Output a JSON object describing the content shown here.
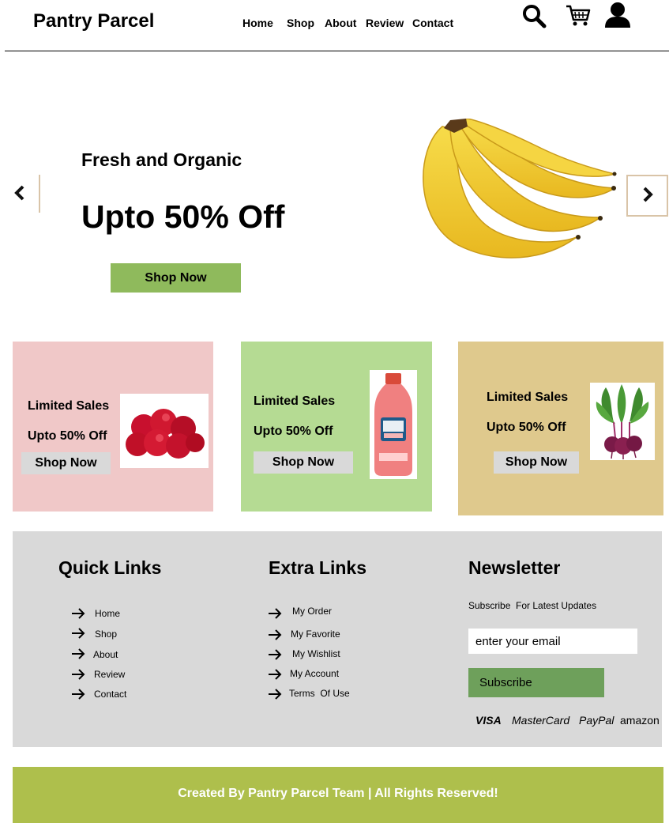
{
  "header": {
    "brand": "Pantry Parcel",
    "nav": [
      "Home",
      "Shop",
      "About",
      "Review",
      "Contact"
    ]
  },
  "hero": {
    "subtitle": "Fresh and Organic",
    "title": "Upto 50% Off",
    "button": "Shop Now"
  },
  "promos": [
    {
      "line1": "Limited Sales",
      "line2": "Upto 50% Off",
      "button": "Shop Now",
      "bg": "#f0c8c8",
      "image": "apples"
    },
    {
      "line1": "Limited Sales",
      "line2": "Upto 50% Off",
      "button": "Shop Now",
      "bg": "#b5db93",
      "image": "juice-bottle"
    },
    {
      "line1": "Limited Sales",
      "line2": "Upto 50% Off",
      "button": "Shop Now",
      "bg": "#dfc98d",
      "image": "beets"
    }
  ],
  "footer": {
    "quick_title": "Quick Links",
    "quick_links": [
      "Home",
      "Shop",
      "About",
      "Review",
      "Contact"
    ],
    "extra_title": "Extra Links",
    "extra_links": [
      "My Order",
      "My Favorite",
      "My Wishlist",
      "My Account",
      "Terms  Of Use"
    ],
    "newsletter_title": "Newsletter",
    "newsletter_text": "Subscribe  For Latest Updates",
    "email_value": "enter your email",
    "subscribe_label": "Subscribe",
    "payments": [
      "VISA",
      "MasterCard",
      "PayPal",
      "amazon"
    ]
  },
  "bottom": {
    "credit": "Created By Pantry Parcel Team | All Rights Reserved!"
  },
  "icons": [
    "search-icon",
    "cart-icon",
    "user-icon",
    "chevron-left-icon",
    "chevron-right-icon",
    "arrow-right-icon"
  ],
  "colors": {
    "hero_button": "#8fba5c",
    "subscribe": "#6ea05b",
    "bottom_bar": "#aebf4c",
    "footer_bg": "#d9d9d9"
  }
}
